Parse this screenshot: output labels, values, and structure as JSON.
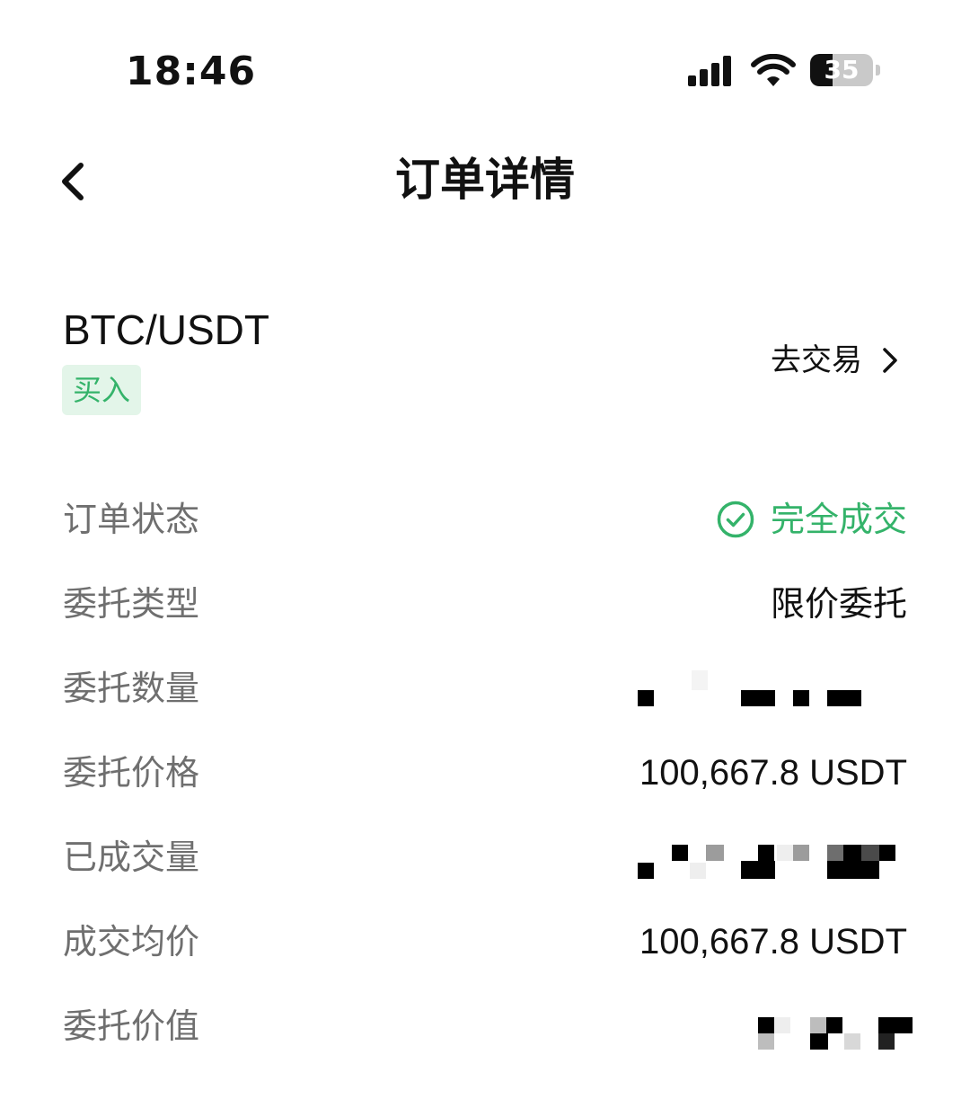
{
  "status_bar": {
    "time": "18:46",
    "battery_level": "35",
    "icons": [
      "signal-icon",
      "wifi-icon",
      "battery-icon"
    ]
  },
  "nav": {
    "title": "订单详情",
    "back_icon": "chevron-left-icon"
  },
  "order_header": {
    "pair": "BTC/USDT",
    "side": "买入",
    "go_trade_label": "去交易",
    "go_trade_icon": "chevron-right-icon"
  },
  "details": [
    {
      "label": "订单状态",
      "value": "完全成交",
      "icon": "check-circle-icon"
    },
    {
      "label": "委托类型",
      "value": "限价委托"
    },
    {
      "label": "委托数量",
      "value": ""
    },
    {
      "label": "委托价格",
      "value": "100,667.8 USDT"
    },
    {
      "label": "已成交量",
      "value": ""
    },
    {
      "label": "成交均价",
      "value": "100,667.8 USDT"
    },
    {
      "label": "委托价值",
      "value": ""
    }
  ],
  "colors": {
    "accent_green": "#34b36a",
    "badge_bg": "#e3f5e9",
    "label_gray": "#6f6f6f",
    "text_dark": "#111111"
  }
}
